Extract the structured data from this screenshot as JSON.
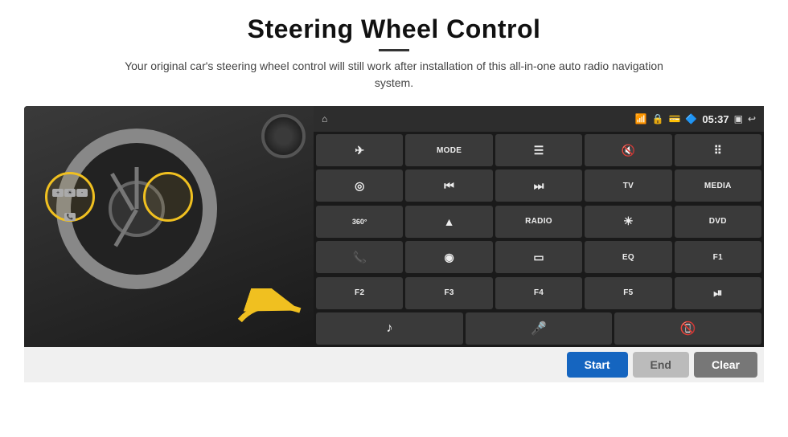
{
  "page": {
    "title": "Steering Wheel Control",
    "subtitle": "Your original car's steering wheel control will still work after installation of this all-in-one auto radio navigation system."
  },
  "status_bar": {
    "time": "05:37",
    "icons": [
      "home",
      "wifi",
      "lock",
      "sd",
      "bluetooth",
      "windows",
      "back"
    ]
  },
  "grid_buttons": [
    {
      "id": "row1_1",
      "icon": "✈",
      "text": ""
    },
    {
      "id": "row1_2",
      "icon": "",
      "text": "MODE"
    },
    {
      "id": "row1_3",
      "icon": "☰",
      "text": ""
    },
    {
      "id": "row1_4",
      "icon": "🔇",
      "text": ""
    },
    {
      "id": "row1_5",
      "icon": "⠿",
      "text": ""
    },
    {
      "id": "row2_1",
      "icon": "◎",
      "text": ""
    },
    {
      "id": "row2_2",
      "icon": "⏮",
      "text": ""
    },
    {
      "id": "row2_3",
      "icon": "⏭",
      "text": ""
    },
    {
      "id": "row2_4",
      "icon": "",
      "text": "TV"
    },
    {
      "id": "row2_5",
      "icon": "",
      "text": "MEDIA"
    },
    {
      "id": "row3_1",
      "icon": "360",
      "text": ""
    },
    {
      "id": "row3_2",
      "icon": "▲",
      "text": ""
    },
    {
      "id": "row3_3",
      "icon": "",
      "text": "RADIO"
    },
    {
      "id": "row3_4",
      "icon": "☀",
      "text": ""
    },
    {
      "id": "row3_5",
      "icon": "",
      "text": "DVD"
    },
    {
      "id": "row4_1",
      "icon": "📞",
      "text": ""
    },
    {
      "id": "row4_2",
      "icon": "◉",
      "text": ""
    },
    {
      "id": "row4_3",
      "icon": "▭",
      "text": ""
    },
    {
      "id": "row4_4",
      "icon": "",
      "text": "EQ"
    },
    {
      "id": "row4_5",
      "icon": "",
      "text": "F1"
    },
    {
      "id": "row5_1",
      "icon": "",
      "text": "F2"
    },
    {
      "id": "row5_2",
      "icon": "",
      "text": "F3"
    },
    {
      "id": "row5_3",
      "icon": "",
      "text": "F4"
    },
    {
      "id": "row5_4",
      "icon": "",
      "text": "F5"
    },
    {
      "id": "row5_5",
      "icon": "⏯",
      "text": ""
    }
  ],
  "music_row_buttons": [
    {
      "id": "music",
      "icon": "♪"
    },
    {
      "id": "mic",
      "icon": "🎤"
    },
    {
      "id": "phone",
      "icon": "📵"
    }
  ],
  "bottom_buttons": {
    "start": "Start",
    "end": "End",
    "clear": "Clear"
  }
}
